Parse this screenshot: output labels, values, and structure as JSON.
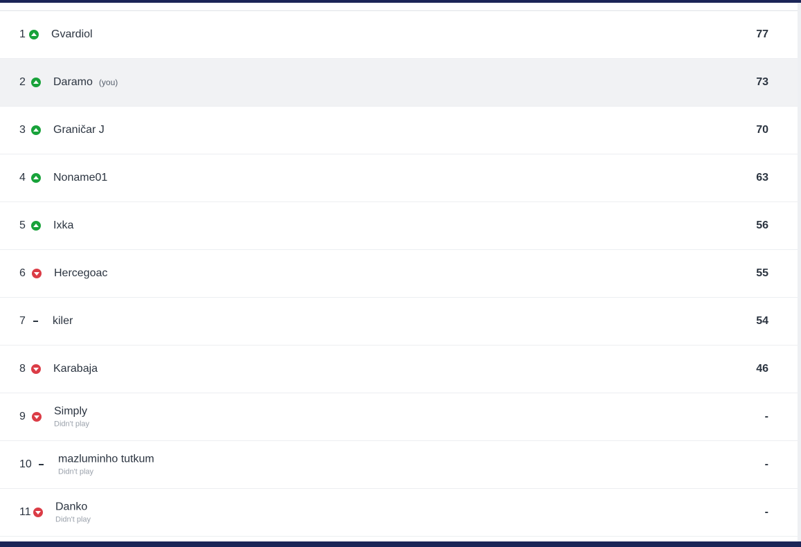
{
  "colors": {
    "up": "#18a23a",
    "down": "#db3c46",
    "frame": "#1b2557",
    "highlight_row": "#f1f2f4"
  },
  "standings": [
    {
      "rank": "1",
      "movement": "up",
      "name": "Gvardiol",
      "tag": "",
      "status": "",
      "points": "77"
    },
    {
      "rank": "2",
      "movement": "up",
      "name": "Daramo",
      "tag": "(you)",
      "status": "",
      "points": "73"
    },
    {
      "rank": "3",
      "movement": "up",
      "name": "Graničar J",
      "tag": "",
      "status": "",
      "points": "70"
    },
    {
      "rank": "4",
      "movement": "up",
      "name": "Noname01",
      "tag": "",
      "status": "",
      "points": "63"
    },
    {
      "rank": "5",
      "movement": "up",
      "name": "Ixka",
      "tag": "",
      "status": "",
      "points": "56"
    },
    {
      "rank": "6",
      "movement": "down",
      "name": "Hercegoac",
      "tag": "",
      "status": "",
      "points": "55"
    },
    {
      "rank": "7",
      "movement": "same",
      "name": "kiler",
      "tag": "",
      "status": "",
      "points": "54"
    },
    {
      "rank": "8",
      "movement": "down",
      "name": "Karabaja",
      "tag": "",
      "status": "",
      "points": "46"
    },
    {
      "rank": "9",
      "movement": "down",
      "name": "Simply",
      "tag": "",
      "status": "Didn't play",
      "points": "-"
    },
    {
      "rank": "10",
      "movement": "same",
      "name": "mazluminho tutkum",
      "tag": "",
      "status": "Didn't play",
      "points": "-"
    },
    {
      "rank": "11",
      "movement": "down",
      "name": "Danko",
      "tag": "",
      "status": "Didn't play",
      "points": "-"
    }
  ]
}
